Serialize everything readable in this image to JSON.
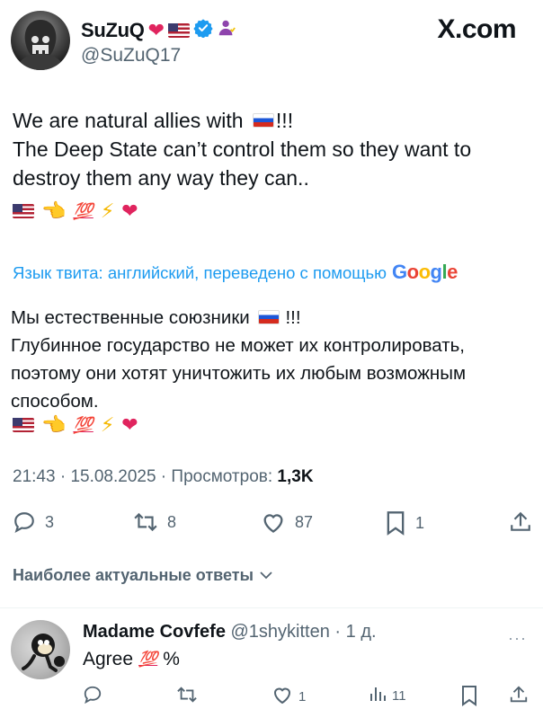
{
  "header": {
    "display_name": "SuZuQ",
    "handle": "@SuZuQ17",
    "site_logo": "X.com",
    "name_icons": [
      "red-heart-icon",
      "us-flag-icon",
      "verified-badge-icon",
      "person-icon"
    ]
  },
  "tweet": {
    "line1_a": "We are natural allies with",
    "line1_b": "!!!",
    "line2": "The Deep State can’t control them so they want to destroy them any way they can..",
    "emojis": [
      "us-flag-icon",
      "backhand-pointing-icon",
      "hundred-points-icon",
      "lightning-icon",
      "red-heart-icon"
    ],
    "hundred": "💯",
    "lightning": "⚡",
    "heart": "❤",
    "point": "👈"
  },
  "translation": {
    "label": "Язык твита: английский, переведено с помощью",
    "provider": "Google",
    "line1_a": "Мы естественные союзники",
    "line1_b": "!!!",
    "line2": "Глубинное государство не может их контролировать, поэтому они хотят уничтожить их любым возможным способом."
  },
  "meta": {
    "time": "21:43",
    "date": "15.08.2025",
    "views_label": "Просмотров:",
    "views": "1,3K"
  },
  "actions": {
    "replies": "3",
    "reposts": "8",
    "likes": "87",
    "bookmarks": "1"
  },
  "sort_label": "Наиболее актуальные ответы",
  "reply": {
    "name": "Madame Covfefe",
    "handle": "@1shykitten",
    "age": "1 д.",
    "text_a": "Agree",
    "text_b": "%",
    "hundred": "💯",
    "more": "···",
    "likes": "1",
    "views": "11"
  },
  "colors": {
    "accent": "#1d9bf0",
    "secondary_text": "#536471",
    "primary_text": "#0f1419"
  }
}
